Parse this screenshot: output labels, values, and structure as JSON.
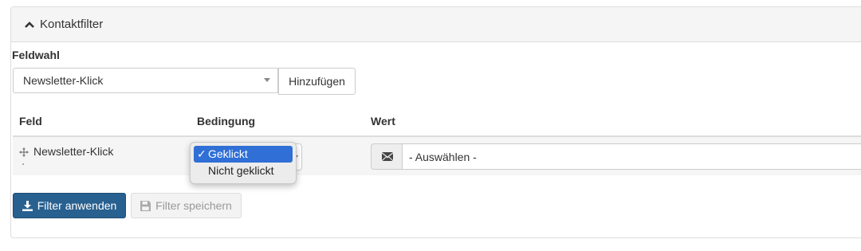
{
  "panel": {
    "title": "Kontaktfilter",
    "toggle_icon": "chevron-up-icon"
  },
  "field_picker": {
    "label": "Feldwahl",
    "selected": "Newsletter-Klick",
    "add_button": "Hinzufügen"
  },
  "table": {
    "columns": [
      "Feld",
      "Bedingung",
      "Wert"
    ],
    "rows": [
      {
        "field": "Newsletter-Klick",
        "condition_options": [
          {
            "label": "Geklickt",
            "selected": true
          },
          {
            "label": "Nicht geklickt",
            "selected": false
          }
        ],
        "value_icon": "envelope-icon",
        "value_placeholder": "- Auswählen -"
      }
    ]
  },
  "actions": {
    "apply": "Filter anwenden",
    "save": "Filter speichern",
    "apply_icon": "download-icon",
    "save_icon": "floppy-disk-icon"
  },
  "colors": {
    "primary": "#286090",
    "selected_option": "#2f6fd6"
  }
}
